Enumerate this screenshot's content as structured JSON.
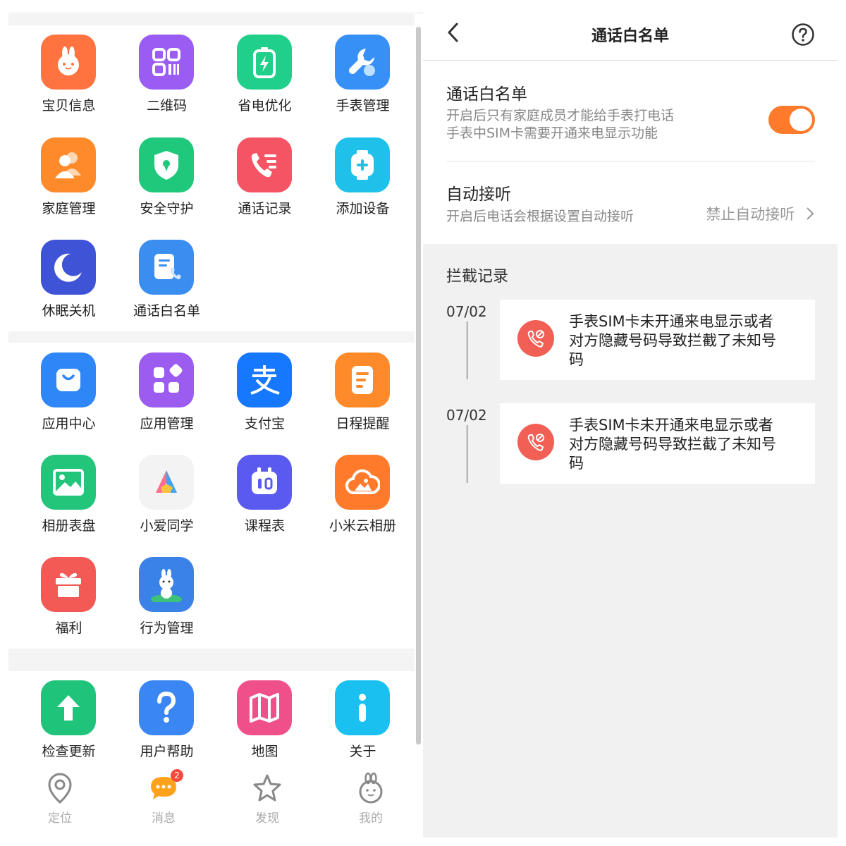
{
  "apps": {
    "group1": [
      {
        "label": "宝贝信息",
        "icon": "bunny-face-icon",
        "color": "#ff7340"
      },
      {
        "label": "二维码",
        "icon": "qr-code-icon",
        "color": "#9a5cf2"
      },
      {
        "label": "省电优化",
        "icon": "battery-icon",
        "color": "#1fcf8a"
      },
      {
        "label": "手表管理",
        "icon": "wrench-icon",
        "color": "#3790f5"
      },
      {
        "label": "家庭管理",
        "icon": "family-icon",
        "color": "#ff8a2a"
      },
      {
        "label": "安全守护",
        "icon": "shield-icon",
        "color": "#1fc87a"
      },
      {
        "label": "通话记录",
        "icon": "call-log-icon",
        "color": "#f45463"
      },
      {
        "label": "添加设备",
        "icon": "add-device-icon",
        "color": "#1fc1ea"
      },
      {
        "label": "休眠关机",
        "icon": "moon-icon",
        "color": "#3e53d6"
      },
      {
        "label": "通话白名单",
        "icon": "call-whitelist-icon",
        "color": "#3a8ef0"
      }
    ],
    "group2": [
      {
        "label": "应用中心",
        "icon": "shopping-bag-icon",
        "color": "#2f86f6"
      },
      {
        "label": "应用管理",
        "icon": "app-grid-icon",
        "color": "#9c5cf0"
      },
      {
        "label": "支付宝",
        "icon": "alipay-icon",
        "color": "#1677ff"
      },
      {
        "label": "日程提醒",
        "icon": "schedule-icon",
        "color": "#ff8a2a"
      },
      {
        "label": "相册表盘",
        "icon": "photo-icon",
        "color": "#22c57a"
      },
      {
        "label": "小爱同学",
        "icon": "xiaoai-icon",
        "color": "#f3f3f3"
      },
      {
        "label": "课程表",
        "icon": "timetable-icon",
        "color": "#5a5af0"
      },
      {
        "label": "小米云相册",
        "icon": "cloud-photo-icon",
        "color": "#ff7a2b"
      },
      {
        "label": "福利",
        "icon": "gift-icon",
        "color": "#f45a55"
      },
      {
        "label": "行为管理",
        "icon": "astronaut-bunny-icon",
        "color": "#3b82e8"
      }
    ],
    "group3": [
      {
        "label": "检查更新",
        "icon": "upload-arrow-icon",
        "color": "#1fc47a"
      },
      {
        "label": "用户帮助",
        "icon": "question-icon",
        "color": "#3a86f2"
      },
      {
        "label": "地图",
        "icon": "map-icon",
        "color": "#f0508a"
      },
      {
        "label": "关于",
        "icon": "info-icon",
        "color": "#19c0f0"
      }
    ]
  },
  "tabbar": {
    "items": [
      {
        "label": "定位",
        "icon": "location-pin-icon"
      },
      {
        "label": "消息",
        "icon": "chat-bubble-icon",
        "badge": "2"
      },
      {
        "label": "发现",
        "icon": "star-icon"
      },
      {
        "label": "我的",
        "icon": "bunny-profile-icon"
      }
    ]
  },
  "whitelist": {
    "title": "通话白名单",
    "whitelist_setting": {
      "title": "通话白名单",
      "desc_line1": "开启后只有家庭成员才能给手表打电话",
      "desc_line2": "手表中SIM卡需要开通来电显示功能",
      "enabled": true
    },
    "auto_answer": {
      "title": "自动接听",
      "desc": "开启后电话会根据设置自动接听",
      "value": "禁止自动接听"
    },
    "intercept_section": "拦截记录",
    "records": [
      {
        "date": "07/02",
        "text": "手表SIM卡未开通来电显示或者对方隐藏号码导致拦截了未知号码"
      },
      {
        "date": "07/02",
        "text": "手表SIM卡未开通来电显示或者对方隐藏号码导致拦截了未知号码"
      }
    ]
  },
  "colors": {
    "accent_orange": "#ff7a2b",
    "record_icon_red": "#f15f55",
    "page_gray": "#f1f1f1"
  }
}
